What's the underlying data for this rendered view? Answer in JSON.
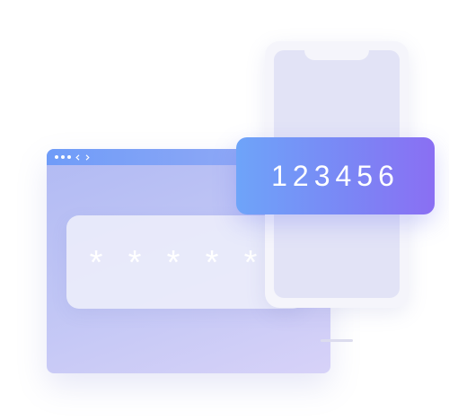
{
  "password_field": {
    "masked_value": [
      "*",
      "*",
      "*",
      "*",
      "*"
    ]
  },
  "code_card": {
    "code": "123456"
  },
  "browser": {
    "controls": [
      "dot",
      "dot",
      "dot",
      "chevron-left-icon",
      "chevron-right-icon"
    ]
  },
  "colors": {
    "browser_bar": "#6f9cf8",
    "browser_body": "#b1baf3",
    "code_card_start": "#6ea4f9",
    "code_card_end": "#8a6ff3",
    "phone_screen": "#e2e3f6"
  }
}
